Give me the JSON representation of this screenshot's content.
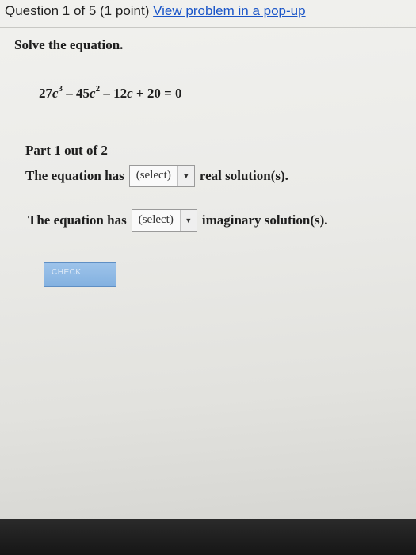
{
  "header": {
    "question_text": "Question 1 of 5 (1 point) ",
    "popup_link": "View problem in a pop-up"
  },
  "problem": {
    "title": "Solve the equation.",
    "equation": {
      "term1_coef": "27",
      "term1_var": "c",
      "term1_exp": "3",
      "op1": " – ",
      "term2_coef": "45",
      "term2_var": "c",
      "term2_exp": "2",
      "op2": " – ",
      "term3_coef": "12",
      "term3_var": "c",
      "op3": " + ",
      "constant": "20",
      "rhs": " = 0"
    }
  },
  "part": {
    "label": "Part 1 out of 2"
  },
  "row1": {
    "prefix": "The equation has",
    "select_value": "(select)",
    "suffix": "real solution(s)."
  },
  "row2": {
    "prefix": "The equation has",
    "select_value": "(select)",
    "suffix": "imaginary solution(s)."
  },
  "check_button": {
    "label": "CHECK"
  },
  "icons": {
    "dropdown": "triangle-down-icon"
  },
  "colors": {
    "link": "#1a55c8",
    "check_button": "#8ab6e4"
  }
}
